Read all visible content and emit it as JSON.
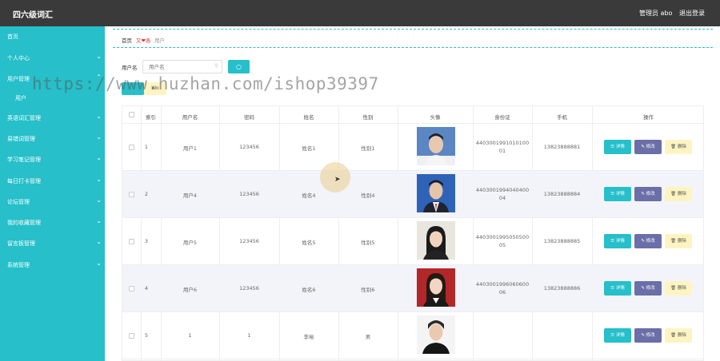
{
  "header": {
    "title": "四六级词汇",
    "admin": "管理员 abo",
    "logout": "退出登录"
  },
  "sidebar": {
    "items": [
      {
        "label": "首页",
        "chevron": false
      },
      {
        "label": "个人中心",
        "chevron": true
      },
      {
        "label": "用户管理",
        "chevron": true
      },
      {
        "label": "用户",
        "chevron": false
      },
      {
        "label": "英语词汇管理",
        "chevron": true
      },
      {
        "label": "易错词管理",
        "chevron": true
      },
      {
        "label": "学习笔记管理",
        "chevron": true
      },
      {
        "label": "每日打卡管理",
        "chevron": true
      },
      {
        "label": "论坛管理",
        "chevron": true
      },
      {
        "label": "我的收藏管理",
        "chevron": true
      },
      {
        "label": "留言板管理",
        "chevron": true
      },
      {
        "label": "系统管理",
        "chevron": true
      }
    ]
  },
  "breadcrumb": {
    "home": "首页",
    "sep": "又❤各",
    "current": "用户"
  },
  "search": {
    "label": "用户名",
    "placeholder": "用户名",
    "button": "○"
  },
  "toolbar": {
    "delete_label": "Wo"
  },
  "table": {
    "headers": [
      "",
      "索引",
      "用户名",
      "密码",
      "姓名",
      "性别",
      "头像",
      "身份证",
      "手机",
      "操作"
    ],
    "rows": [
      {
        "index": "1",
        "username": "用户1",
        "password": "123456",
        "name": "姓名1",
        "gender": "性别1",
        "id_line1": "4403001991010100",
        "id_line2": "01",
        "phone": "13823888881",
        "avatar_style": "male-suit-blue"
      },
      {
        "index": "2",
        "username": "用户4",
        "password": "123456",
        "name": "姓名4",
        "gender": "性别4",
        "id_line1": "4403001994040400",
        "id_line2": "04",
        "phone": "13823888884",
        "avatar_style": "male-suit-blue2"
      },
      {
        "index": "3",
        "username": "用户5",
        "password": "123456",
        "name": "姓名5",
        "gender": "性别5",
        "id_line1": "4403001995050500",
        "id_line2": "05",
        "phone": "13823888885",
        "avatar_style": "female-light"
      },
      {
        "index": "4",
        "username": "用户6",
        "password": "123456",
        "name": "姓名6",
        "gender": "性别6",
        "id_line1": "4403001996060600",
        "id_line2": "06",
        "phone": "13823888886",
        "avatar_style": "female-red"
      },
      {
        "index": "5",
        "username": "1",
        "password": "1",
        "name": "李裕",
        "gender": "男",
        "id_line1": "",
        "id_line2": "",
        "phone": "",
        "avatar_style": "male-casual"
      }
    ],
    "actions": {
      "detail": "☰ 详情",
      "edit": "✎ 修改",
      "delete": "🗑 删除"
    }
  },
  "watermark": "https://www.huzhan.com/ishop39397",
  "colors": {
    "accent": "#26bfca",
    "edit": "#6b6fa8",
    "delete": "#fdf4c2",
    "topbar": "#3a3a3a"
  }
}
